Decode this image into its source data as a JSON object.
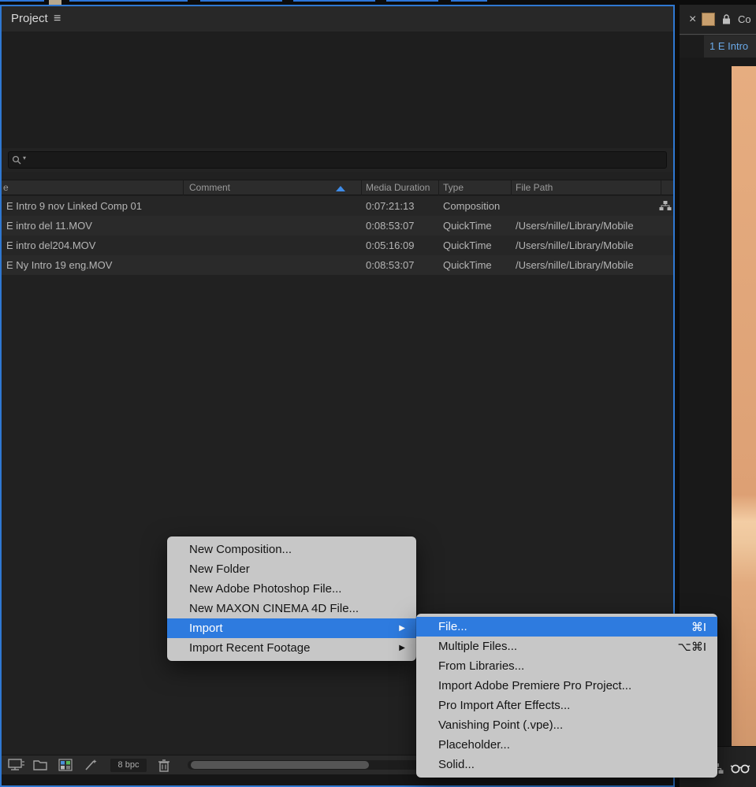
{
  "colors": {
    "accent_blue": "#2e7bdf",
    "peach": "#e2a87c"
  },
  "project_panel": {
    "title": "Project",
    "menu_icon_glyph": "≡",
    "search": {
      "placeholder": ""
    },
    "table": {
      "columns": {
        "name": "e",
        "comment": "Comment",
        "duration": "Media Duration",
        "type": "Type",
        "path": "File Path"
      },
      "rows": [
        {
          "name": "E Intro 9 nov Linked Comp 01",
          "duration": "0:07:21:13",
          "type": "Composition",
          "path": ""
        },
        {
          "name": "E intro del 11.MOV",
          "duration": "0:08:53:07",
          "type": "QuickTime",
          "path": "/Users/nille/Library/Mobile"
        },
        {
          "name": "E intro del204.MOV",
          "duration": "0:05:16:09",
          "type": "QuickTime",
          "path": "/Users/nille/Library/Mobile"
        },
        {
          "name": "E Ny Intro 19 eng.MOV",
          "duration": "0:08:53:07",
          "type": "QuickTime",
          "path": "/Users/nille/Library/Mobile"
        }
      ]
    },
    "footer": {
      "bpc_label": "8 bpc"
    }
  },
  "context_menu": {
    "items": [
      {
        "label": "New Composition..."
      },
      {
        "label": "New Folder"
      },
      {
        "label": "New Adobe Photoshop File..."
      },
      {
        "label": "New MAXON CINEMA 4D File..."
      },
      {
        "label": "Import",
        "arrow": "▶"
      },
      {
        "label": "Import Recent Footage",
        "arrow": "▶"
      }
    ]
  },
  "import_submenu": {
    "items": [
      {
        "label": "File...",
        "shortcut": "⌘I"
      },
      {
        "label": "Multiple Files...",
        "shortcut": "⌥⌘I"
      },
      {
        "label": "From Libraries...",
        "shortcut": ""
      },
      {
        "label": "Import Adobe Premiere Pro Project...",
        "shortcut": ""
      },
      {
        "label": "Pro Import After Effects...",
        "shortcut": ""
      },
      {
        "label": "Vanishing Point (.vpe)...",
        "shortcut": ""
      },
      {
        "label": "Placeholder...",
        "shortcut": ""
      },
      {
        "label": "Solid...",
        "shortcut": ""
      }
    ]
  },
  "right_panel": {
    "close_glyph": "×",
    "header_label": "Co",
    "tab_label": "1 E Intro"
  }
}
